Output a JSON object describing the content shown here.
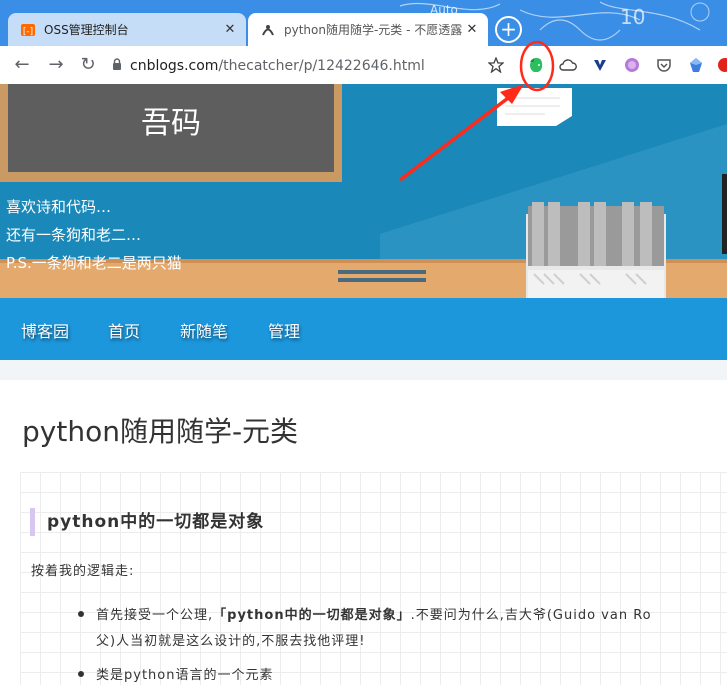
{
  "browser": {
    "tabs": [
      {
        "title": "OSS管理控制台",
        "close": "✕"
      },
      {
        "title": "python随用随学-元类 - 不愿透露",
        "close": "✕"
      }
    ],
    "new_tab": "+",
    "url_host": "cnblogs.com",
    "url_path": "/thecatcher/p/12422646.html",
    "toolbar_icons": [
      "star-icon",
      "evernote-icon",
      "cloud-icon",
      "vimium-icon",
      "extension-icon",
      "pocket-icon",
      "extension-icon",
      "extension-icon"
    ]
  },
  "blog": {
    "chalkboard_title": "吾码",
    "taglines": [
      "喜欢诗和代码…",
      "还有一条狗和老二…",
      "P.S.一条狗和老二是两只猫"
    ],
    "nav": [
      "博客园",
      "首页",
      "新随笔",
      "管理"
    ]
  },
  "post": {
    "title": "python随用随学-元类",
    "section_heading": "python中的一切都是对象",
    "intro": "按着我的逻辑走:",
    "bullets": [
      {
        "before": "首先接受一个公理,",
        "strong": "「python中的一切都是对象」",
        "after": ".不要问为什么,吉大爷(Guido van Ro",
        "cont": "父)人当初就是这么设计的,不服去找他评理!"
      },
      {
        "text": "类是python语言的一个元素"
      }
    ]
  },
  "colors": {
    "tabstrip": "#3a8ee6",
    "hero": "#1a88b8",
    "nav": "#1d97dc",
    "annotation": "#ff2a1a",
    "evernote": "#2dbe60"
  }
}
